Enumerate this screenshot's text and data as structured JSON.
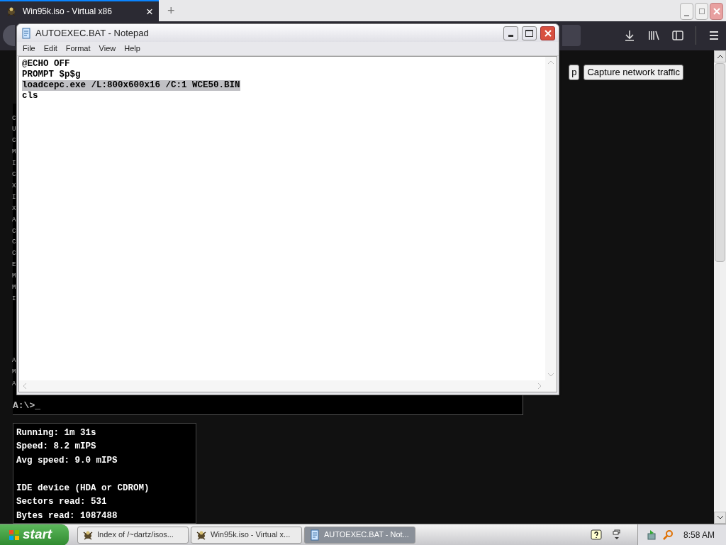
{
  "browser": {
    "tab": {
      "title": "Win95k.iso - Virtual x86",
      "close": "×",
      "selected": true
    },
    "new_tab": "+"
  },
  "page": {
    "buttons": [
      {
        "label": "p"
      },
      {
        "label": "Capture network traffic"
      }
    ],
    "terminal": {
      "edge_chars_top": [
        "C",
        "U",
        "C",
        "M",
        "I",
        "C",
        "X",
        "I",
        "X",
        "A",
        "C",
        "C",
        "C",
        "E",
        "M",
        "M",
        "I"
      ],
      "edge_chars_bottom": [
        "A",
        "M",
        "A"
      ],
      "prompt": "A:\\>_"
    },
    "stats": [
      [
        "Running: 1m 31s",
        "Speed: 8.2 mIPS",
        "Avg speed: 9.0 mIPS"
      ],
      [
        "IDE device (HDA or CDROM)",
        "Sectors read: 531",
        "Bytes read: 1087488"
      ]
    ]
  },
  "notepad": {
    "title": "AUTOEXEC.BAT - Notepad",
    "menu": [
      "File",
      "Edit",
      "Format",
      "View",
      "Help"
    ],
    "lines": [
      {
        "text": "@ECHO OFF",
        "selected": false
      },
      {
        "text": "PROMPT $p$g",
        "selected": false
      },
      {
        "text": "loadcepc.exe /L:800x600x16 /C:1 WCE50.BIN",
        "selected": true
      },
      {
        "text": "cls",
        "selected": false
      }
    ]
  },
  "taskbar": {
    "start": "start",
    "tasks": [
      {
        "label": "Index of /~dartz/isos...",
        "kind": "emulator",
        "selected": false
      },
      {
        "label": "Win95k.iso - Virtual x...",
        "kind": "emulator",
        "selected": false
      },
      {
        "label": "AUTOEXEC.BAT - Not...",
        "kind": "notepad",
        "selected": true
      }
    ],
    "clock": "8:58 AM"
  }
}
